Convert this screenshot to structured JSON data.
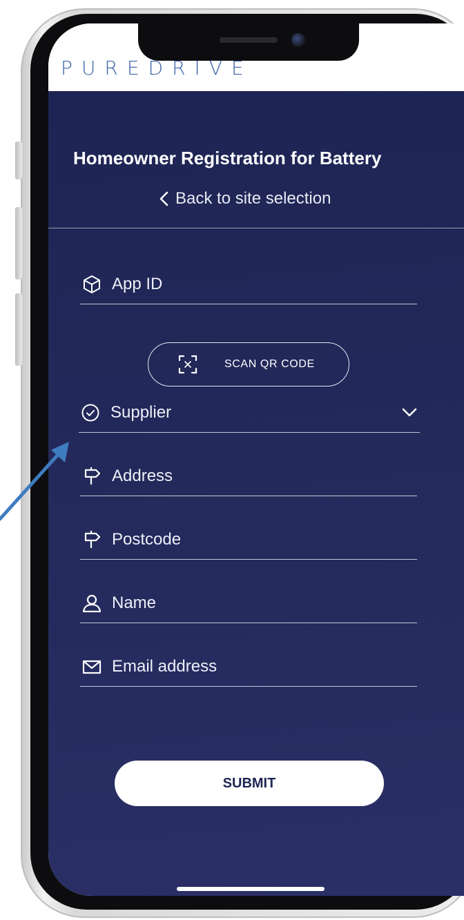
{
  "app": {
    "logo": "PUREDRIVE"
  },
  "page": {
    "title": "Homeowner Registration for Battery",
    "back_label": "Back to site selection"
  },
  "form": {
    "app_id": {
      "placeholder": "App ID",
      "icon": "cube-icon"
    },
    "scan_button": {
      "label": "SCAN QR CODE",
      "icon": "qr-scan-icon"
    },
    "supplier": {
      "placeholder": "Supplier",
      "icon": "check-circle-icon"
    },
    "address": {
      "placeholder": "Address",
      "icon": "signpost-icon"
    },
    "postcode": {
      "placeholder": "Postcode",
      "icon": "signpost-icon"
    },
    "name": {
      "placeholder": "Name",
      "icon": "user-icon"
    },
    "email": {
      "placeholder": "Email address",
      "icon": "mail-icon"
    },
    "submit_label": "SUBMIT"
  },
  "colors": {
    "background": "#1e2554",
    "logo": "#3d63a8",
    "annotation_arrow": "#3f7cc0"
  }
}
